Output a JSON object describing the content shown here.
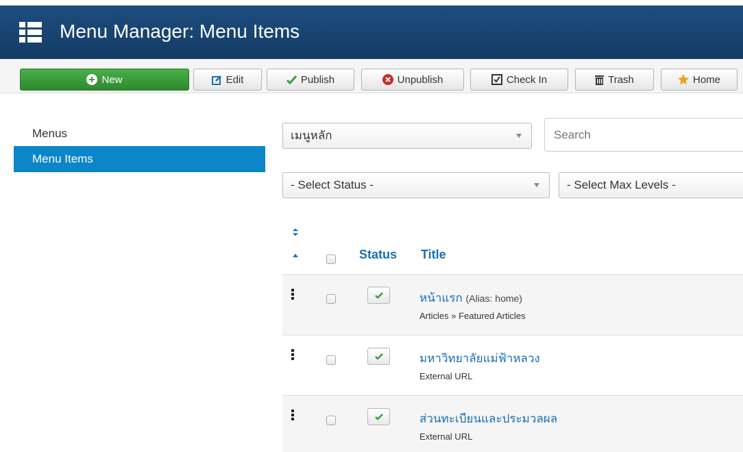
{
  "header": {
    "title": "Menu Manager: Menu Items"
  },
  "toolbar": {
    "new": "New",
    "edit": "Edit",
    "publish": "Publish",
    "unpublish": "Unpublish",
    "check_in": "Check In",
    "trash": "Trash",
    "home": "Home"
  },
  "sidebar": {
    "items": [
      {
        "label": "Menus"
      },
      {
        "label": "Menu Items",
        "active": true
      }
    ]
  },
  "filters": {
    "menu_selected": "เมนูหลัก",
    "search_placeholder": "Search",
    "status": "- Select Status -",
    "max_levels": "- Select Max Levels -"
  },
  "table": {
    "columns": {
      "status": "Status",
      "title": "Title"
    },
    "rows": [
      {
        "title": "หน้าแรก",
        "alias": "(Alias: home)",
        "type": "Articles » Featured Articles"
      },
      {
        "title": "มหาวิทยาลัยแม่ฟ้าหลวง",
        "type": "External URL"
      },
      {
        "title": "ส่วนทะเบียนและประมวลผล",
        "type": "External URL"
      }
    ]
  },
  "colors": {
    "header": "#1e4d7e",
    "accent": "#1a6fb4",
    "new_button": "#3a9d3a",
    "active_sidebar": "#0a86c9"
  }
}
